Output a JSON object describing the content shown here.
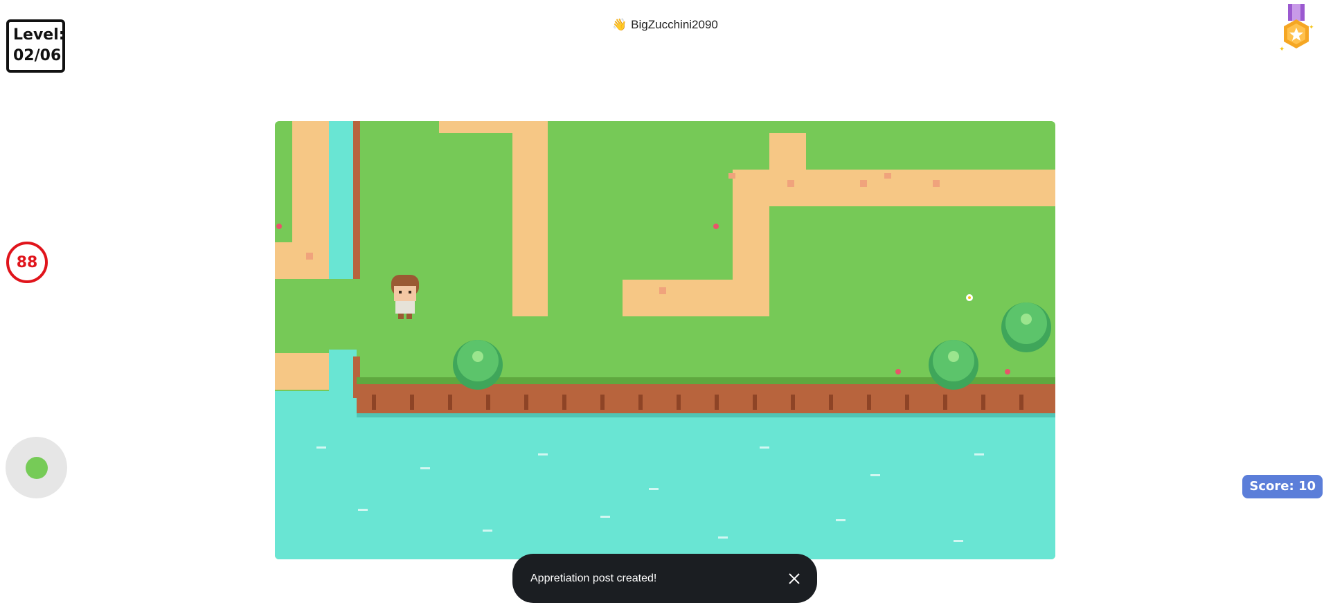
{
  "hud": {
    "level_label": "Level:",
    "level_value": "02/06",
    "timer": "88",
    "score_label": "Score: 10"
  },
  "player": {
    "wave_emoji": "👋",
    "username": "BigZucchini2090"
  },
  "toast": {
    "message": "Appretiation post created!"
  },
  "icons": {
    "medal": "medal-icon",
    "close": "close-icon"
  },
  "colors": {
    "grass": "#76c957",
    "path": "#f6c785",
    "water": "#69e5d3",
    "cliff": "#b8643d",
    "timer_red": "#e0141b",
    "score_blue": "#5b7ed9",
    "toast_bg": "#1b1e22",
    "joystick_knob": "#76cb57"
  }
}
